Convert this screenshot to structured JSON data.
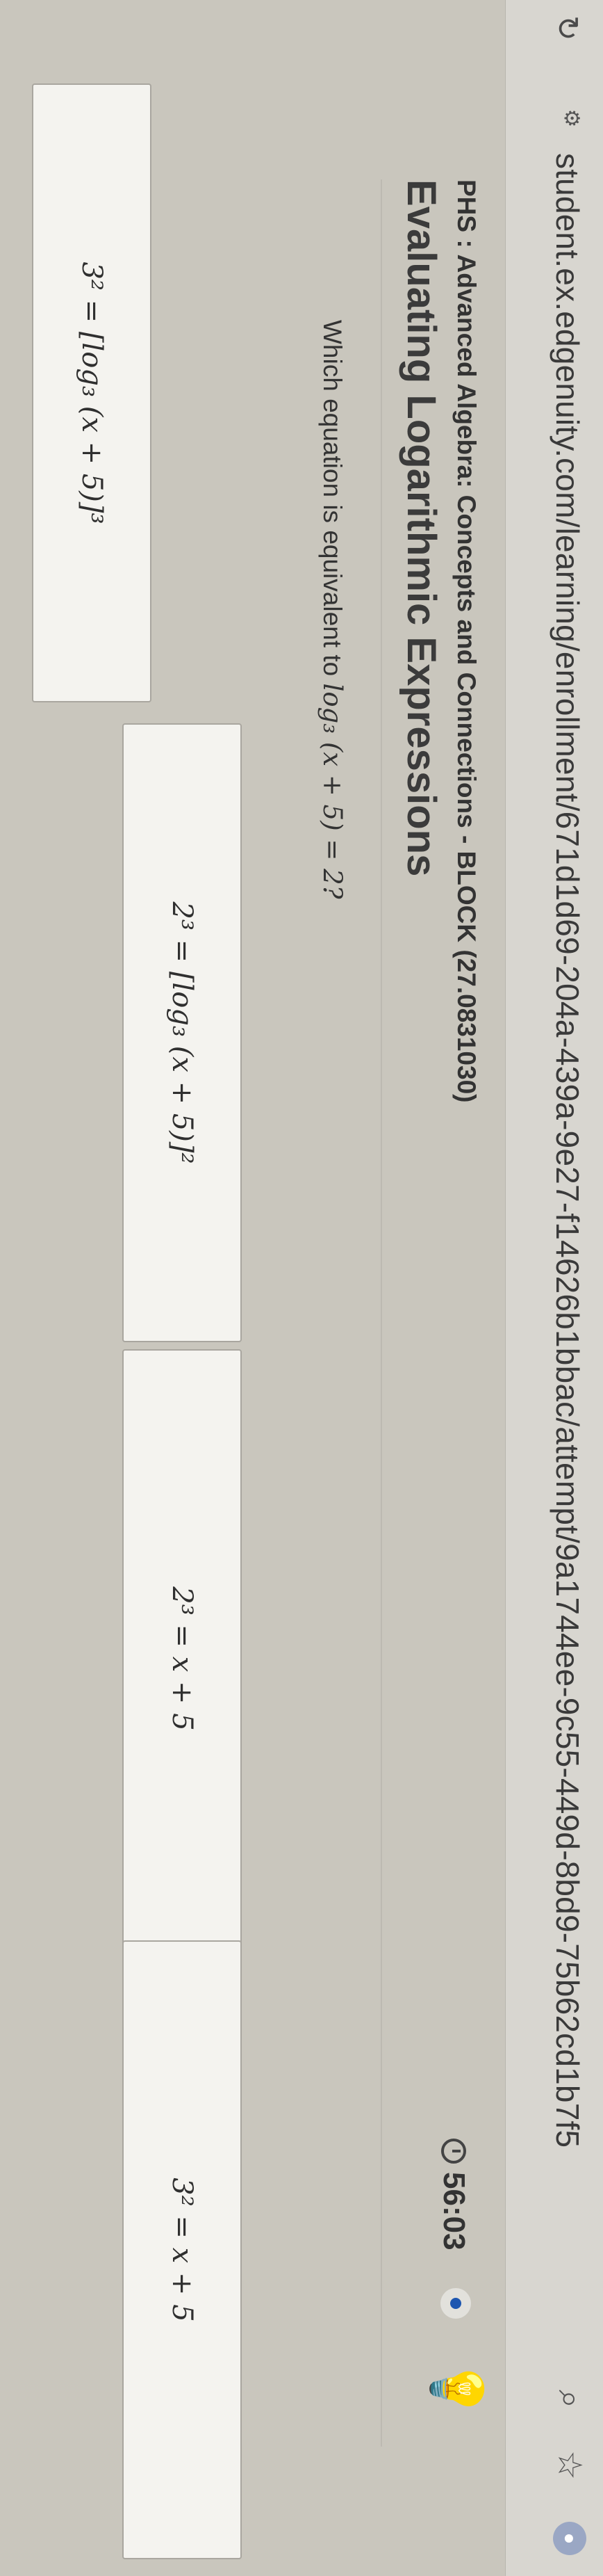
{
  "browser": {
    "url": "student.ex.edgenuity.com/learning/enrollment/671d1d69-204a-439a-9e27-f14626b1bbac/attempt/9a1744ee-9c55-449d-8bd9-75b62cd1b7f5",
    "reload_icon": "reload-icon",
    "site_info_icon": "site-info-icon",
    "search_icon": "search-icon",
    "bookmark_icon": "star-icon",
    "profile_icon": "profile-icon"
  },
  "header": {
    "course": "PHS : Advanced Algebra: Concepts and Connections - BLOCK (27.0831030)",
    "lesson": "Evaluating Logarithmic Expressions",
    "timer": "56:03",
    "timer_icon": "clock-icon",
    "status_icon": "status-dot-icon",
    "hint_icon": "lightbulb-icon"
  },
  "question": {
    "prompt": "Which equation is equivalent to",
    "expression": "log₃ (x + 5) = 2?"
  },
  "choices": [
    {
      "label": "3² = [log₃ (x + 5)]³"
    },
    {
      "label": "2³ = [log₃ (x + 5)]²"
    },
    {
      "label": "2³ = x + 5"
    },
    {
      "label": "3² = x + 5"
    }
  ],
  "colors": {
    "background": "#c9c6bd",
    "choice_bg": "#f4f3ef",
    "hint": "#d9a31e",
    "status": "#1d56b0"
  }
}
